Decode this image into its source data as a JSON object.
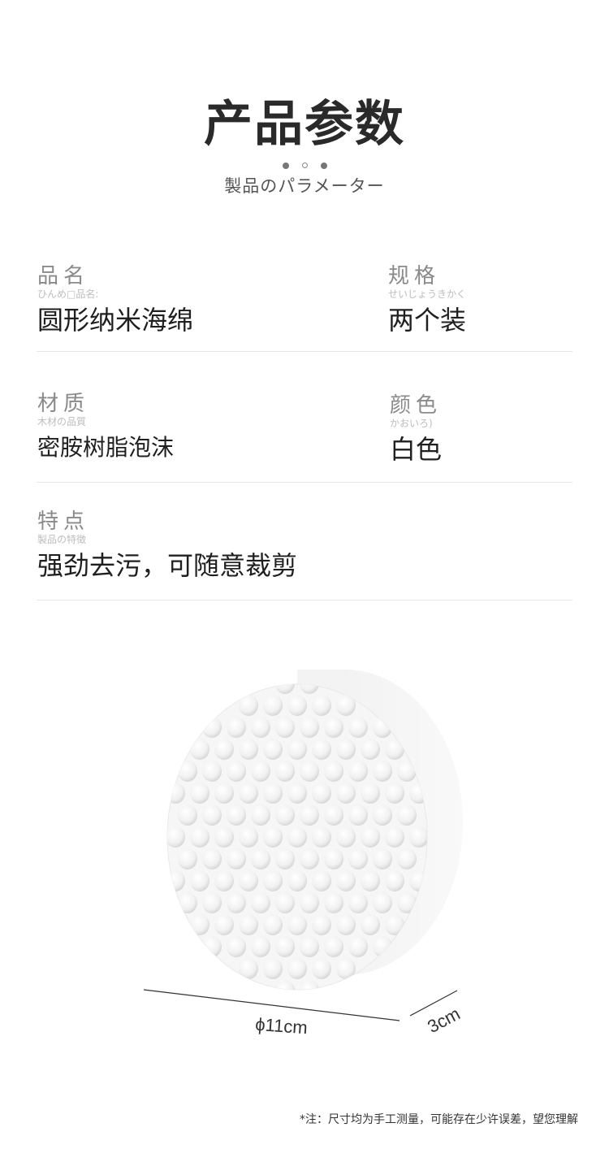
{
  "header": {
    "title": "产品参数",
    "subtitle": "製品のパラメーター"
  },
  "params": {
    "name": {
      "label": "品名",
      "kana": "ひんめ□品名:",
      "value": "圆形纳米海绵"
    },
    "spec": {
      "label": "规格",
      "kana": "せいじょうきかく",
      "value": "两个装"
    },
    "material": {
      "label": "材质",
      "kana": "木材の品質",
      "value": "密胺树脂泡沫"
    },
    "color": {
      "label": "颜色",
      "kana": "かおいろ)",
      "value": "白色"
    },
    "feature": {
      "label": "特点",
      "kana": "製品の特徴",
      "value": "强劲去污，可随意裁剪"
    }
  },
  "product": {
    "diameter_label": "ϕ11cm",
    "thickness_label": "3cm",
    "image_name": "round-nano-sponge-photo"
  },
  "footer": {
    "note": "*注：尺寸均为手工测量，可能存在少许误差，望您理解"
  },
  "colors": {
    "accent_dot": "#777777",
    "divider": "#e6e6e6"
  }
}
